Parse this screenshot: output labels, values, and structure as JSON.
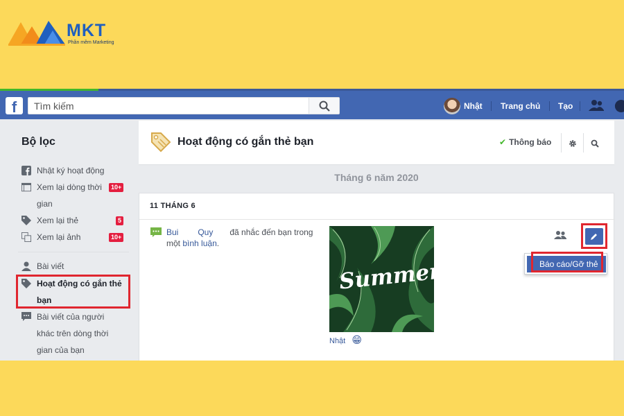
{
  "logo": {
    "text": "MKT",
    "subtitle": "Phần mềm Marketing"
  },
  "topbar": {
    "search_placeholder": "Tìm kiếm",
    "user_name": "Nhật",
    "home_label": "Trang chủ",
    "create_label": "Tạo"
  },
  "sidebar": {
    "title": "Bộ lọc",
    "items": [
      {
        "label": "Nhật ký hoạt động",
        "icon": "facebook-icon"
      },
      {
        "label_line1": "Xem lại dòng thời",
        "label_line2": "gian",
        "badge": "10+",
        "icon": "timeline-icon"
      },
      {
        "label": "Xem lại thẻ",
        "badge": "5",
        "icon": "tag-icon"
      },
      {
        "label": "Xem lại ảnh",
        "badge": "10+",
        "icon": "photos-icon"
      },
      {
        "label": "Bài viết",
        "icon": "person-icon"
      },
      {
        "label_line1": "Hoạt động có gắn thẻ",
        "label_line2": "bạn",
        "icon": "tag-icon",
        "active": true
      },
      {
        "label_line1": "Bài viết của người",
        "label_line2": "khác trên dòng thời",
        "label_line3": "gian của bạn",
        "icon": "comment-icon"
      }
    ]
  },
  "main": {
    "title": "Hoạt động có gắn thẻ bạn",
    "notify_label": "Thông báo",
    "month": "Tháng 6 năm 2020",
    "card": {
      "date": "11 THÁNG 6",
      "actor_first": "Bui",
      "actor_last": "Quy",
      "action": "đã nhắc đến bạn trong",
      "action_line2_prefix": "một",
      "action_link": "bình luận",
      "action_end": ".",
      "photo_text": "Summer",
      "caption": "Nhật",
      "caption_emoji": "😁",
      "menu_item": "Báo cáo/Gỡ thẻ"
    }
  },
  "colors": {
    "background": "#fcd95a",
    "facebook_blue": "#4267b2",
    "highlight_red": "#e0262f",
    "badge_red": "#e41e3f"
  }
}
